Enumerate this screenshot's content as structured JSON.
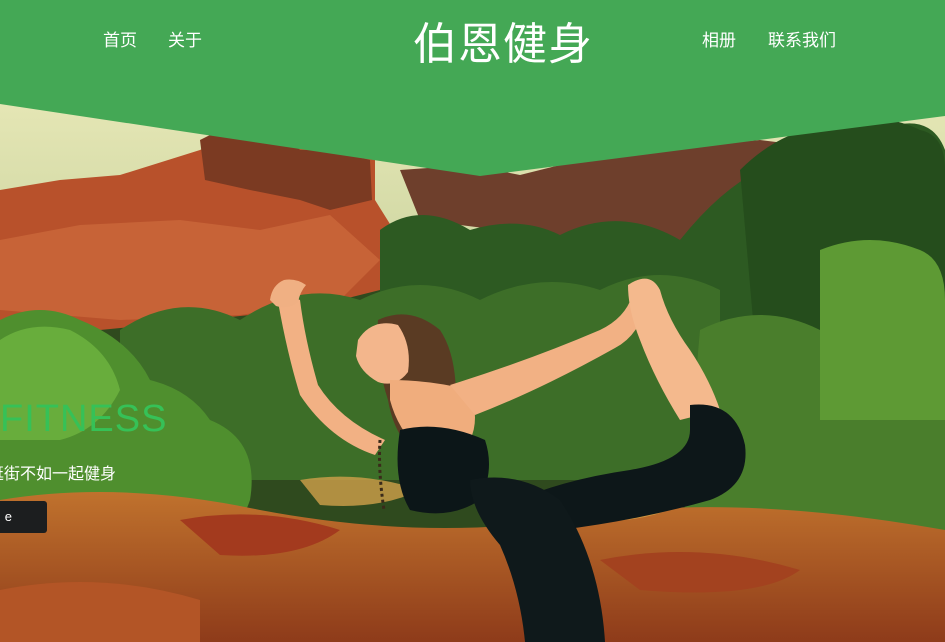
{
  "nav": {
    "left": [
      {
        "label": "首页"
      },
      {
        "label": "关于"
      }
    ],
    "right": [
      {
        "label": "相册"
      },
      {
        "label": "联系我们"
      }
    ]
  },
  "brand": {
    "title": "伯恩健身"
  },
  "hero": {
    "title": "N FITNESS",
    "subtitle": "逛街不如一起健身",
    "button_label": "e",
    "image": "yoga-pose-photo"
  },
  "colors": {
    "header_green": "#44a855",
    "title_green": "#36c157",
    "button_dark": "#1c1e1f"
  }
}
